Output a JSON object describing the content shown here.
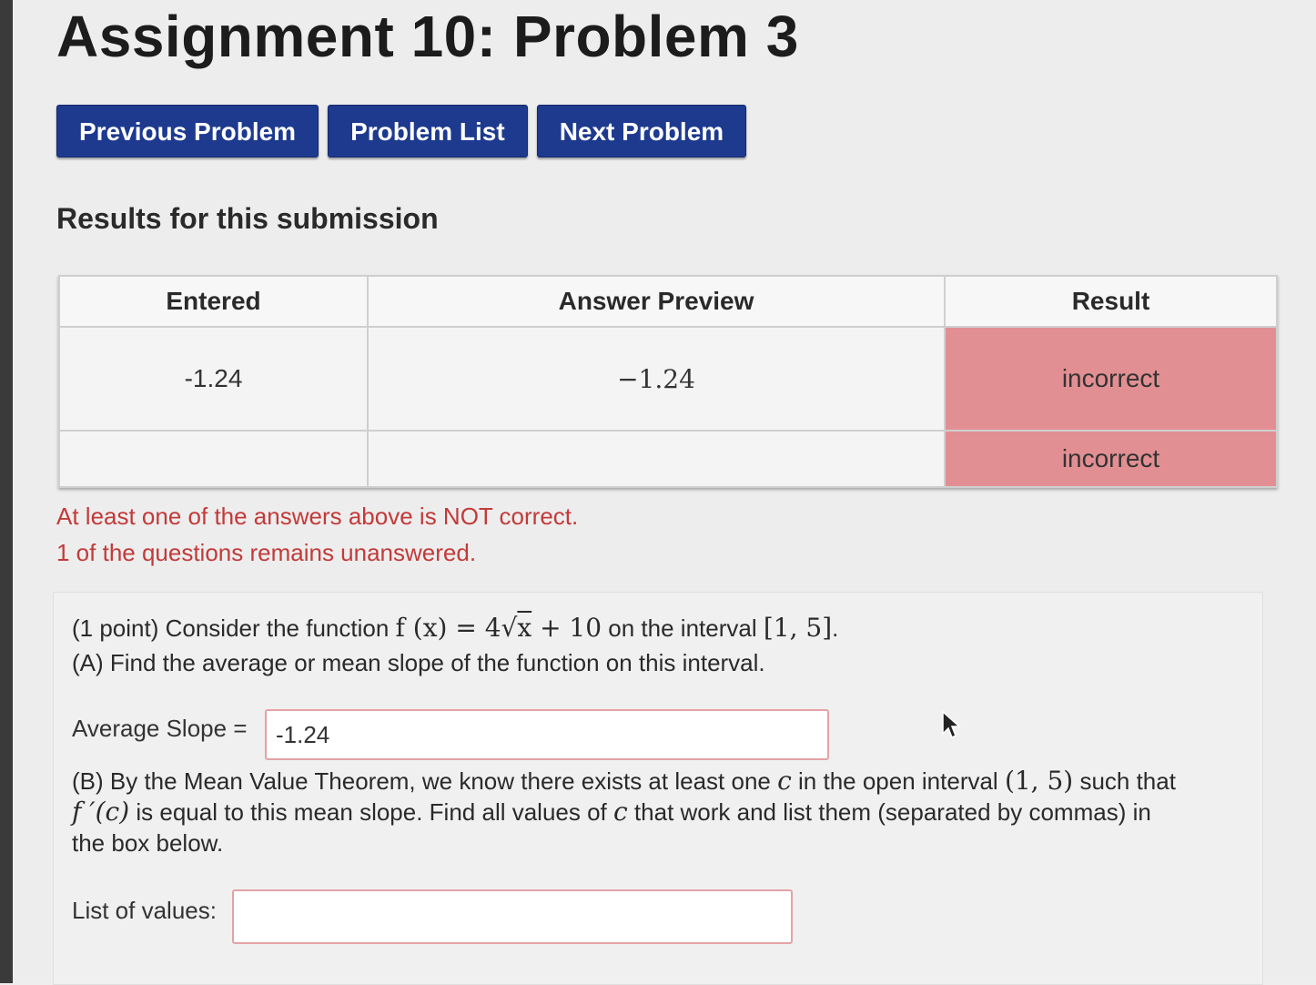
{
  "page": {
    "title": "Assignment 10: Problem 3"
  },
  "nav": {
    "previous_label": "Previous Problem",
    "list_label": "Problem List",
    "next_label": "Next Problem",
    "button_color": "#1d3a8f"
  },
  "results": {
    "heading": "Results for this submission",
    "columns": [
      "Entered",
      "Answer Preview",
      "Result"
    ],
    "rows": [
      {
        "entered": "-1.24",
        "preview": "−1.24",
        "result": "incorrect"
      },
      {
        "entered": "",
        "preview": "",
        "result": "incorrect"
      }
    ],
    "incorrect_color": "#e28f93"
  },
  "messages": {
    "not_correct": "At least one of the answers above is NOT correct.",
    "unanswered": "1 of the questions remains unanswered.",
    "color": "#c23a3a"
  },
  "problem": {
    "intro_prefix": "(1 point) Consider the function ",
    "function_lhs": "f (x) = 4",
    "function_radicand": "x",
    "function_rhs": " + 10",
    "intro_mid": " on the interval ",
    "interval": "[1, 5]",
    "intro_end": ".",
    "part_a": "(A) Find the average or mean slope of the function on this interval.",
    "avg_label": "Average Slope =",
    "avg_value": "-1.24",
    "part_b_1": "(B) By the Mean Value Theorem, we know there exists at least one ",
    "part_b_c1": "c",
    "part_b_2": " in the open interval ",
    "part_b_interval": "(1, 5)",
    "part_b_3": " such that",
    "part_b_fprime": "f ′(c)",
    "part_b_4": " is equal to this mean slope. Find all values of ",
    "part_b_c2": "c",
    "part_b_5": " that work and list them (separated by commas) in",
    "part_b_6": "the box below.",
    "list_label": "List of values:",
    "list_value": ""
  },
  "icons": {
    "cursor": "mouse-pointer-icon"
  }
}
